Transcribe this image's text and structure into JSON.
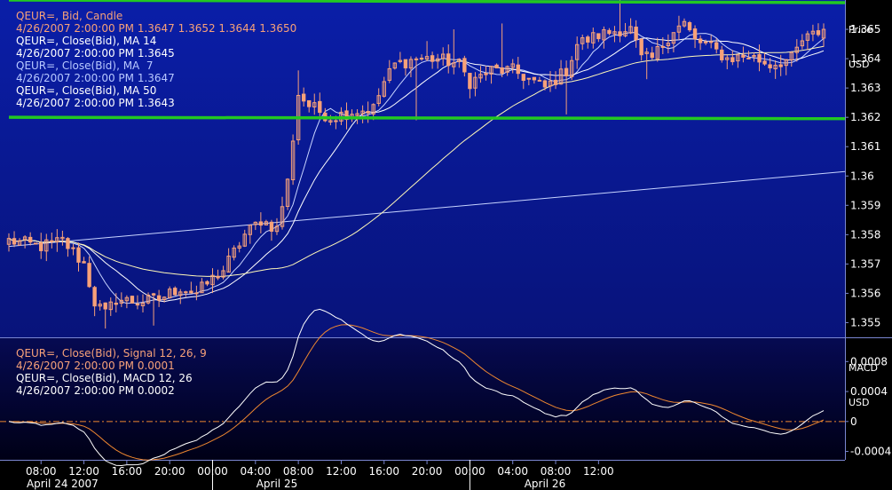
{
  "colors": {
    "background_top": "#0a1ea8",
    "background_bottom": "#000016",
    "candle_up": "#f7a179",
    "candle_down": "#f7a179",
    "ma14": "#ffffff",
    "ma7": "#c8d4ff",
    "ma50": "#fff8b8",
    "trendline": "#c8d4ff",
    "hline": "#22c822",
    "macd": "#ffffff",
    "signal": "#f08830",
    "zero_line": "#f08830",
    "text_orange": "#f7a179",
    "text_white": "#ffffff",
    "text_lightblue": "#b8c8ff"
  },
  "price_legend": [
    {
      "text": "QEUR=, Bid, Candle",
      "color": "orange"
    },
    {
      "text": "4/26/2007 2:00:00 PM 1.3647 1.3652 1.3644 1.3650",
      "color": "orange"
    },
    {
      "text": "QEUR=, Close(Bid), MA 14",
      "color": "white"
    },
    {
      "text": "4/26/2007 2:00:00 PM 1.3645",
      "color": "white"
    },
    {
      "text": "QEUR=, Close(Bid), MA  7",
      "color": "lightblue"
    },
    {
      "text": "4/26/2007 2:00:00 PM 1.3647",
      "color": "lightblue"
    },
    {
      "text": "QEUR=, Close(Bid), MA 50",
      "color": "white"
    },
    {
      "text": "4/26/2007 2:00:00 PM 1.3643",
      "color": "white"
    }
  ],
  "macd_legend": [
    {
      "text": "QEUR=, Close(Bid), Signal 12, 26, 9",
      "color": "orange"
    },
    {
      "text": "4/26/2007 2:00:00 PM 0.0001",
      "color": "orange"
    },
    {
      "text": "QEUR=, Close(Bid), MACD 12, 26",
      "color": "white"
    },
    {
      "text": "4/26/2007 2:00:00 PM 0.0002",
      "color": "white"
    }
  ],
  "price_axis_title": [
    "Price",
    "USD"
  ],
  "macd_axis_title": [
    "MACD",
    "USD"
  ],
  "chart_data": [
    {
      "type": "candlestick",
      "instrument": "QEUR=",
      "ylim": [
        1.3545,
        1.366
      ],
      "yticks": [
        "1.355",
        "1.356",
        "1.357",
        "1.358",
        "1.359",
        "1.36",
        "1.361",
        "1.362",
        "1.363",
        "1.364",
        "1.365",
        "Price"
      ],
      "yticks_values": [
        1.355,
        1.356,
        1.357,
        1.358,
        1.359,
        1.36,
        1.361,
        1.362,
        1.363,
        1.364,
        1.365
      ],
      "grid": false,
      "candle_count": 153,
      "x_start": "4/24/2007 05:00",
      "x_step_minutes": 30,
      "anchors_close": [
        [
          0,
          1.3578
        ],
        [
          6,
          1.3576
        ],
        [
          10,
          1.3578
        ],
        [
          14,
          1.357
        ],
        [
          16,
          1.3557
        ],
        [
          18,
          1.3553
        ],
        [
          20,
          1.3558
        ],
        [
          24,
          1.3557
        ],
        [
          28,
          1.3558
        ],
        [
          32,
          1.3562
        ],
        [
          35,
          1.356
        ],
        [
          38,
          1.3565
        ],
        [
          40,
          1.3568
        ],
        [
          44,
          1.358
        ],
        [
          47,
          1.3585
        ],
        [
          50,
          1.3582
        ],
        [
          52,
          1.3598
        ],
        [
          54,
          1.3628
        ],
        [
          56,
          1.3624
        ],
        [
          60,
          1.362
        ],
        [
          64,
          1.3622
        ],
        [
          68,
          1.3623
        ],
        [
          70,
          1.3632
        ],
        [
          72,
          1.3638
        ],
        [
          76,
          1.364
        ],
        [
          80,
          1.364
        ],
        [
          84,
          1.3638
        ],
        [
          86,
          1.3632
        ],
        [
          90,
          1.3636
        ],
        [
          94,
          1.3636
        ],
        [
          98,
          1.3632
        ],
        [
          100,
          1.363
        ],
        [
          104,
          1.3636
        ],
        [
          106,
          1.3645
        ],
        [
          110,
          1.3648
        ],
        [
          114,
          1.365
        ],
        [
          116,
          1.365
        ],
        [
          118,
          1.364
        ],
        [
          120,
          1.364
        ],
        [
          124,
          1.365
        ],
        [
          126,
          1.3652
        ],
        [
          128,
          1.3646
        ],
        [
          130,
          1.3645
        ],
        [
          134,
          1.364
        ],
        [
          138,
          1.3641
        ],
        [
          142,
          1.3638
        ],
        [
          146,
          1.364
        ],
        [
          148,
          1.3646
        ],
        [
          150,
          1.3648
        ],
        [
          152,
          1.365
        ]
      ],
      "spikes": [
        {
          "index": 18,
          "low": 1.3548
        },
        {
          "index": 27,
          "low": 1.3549
        },
        {
          "index": 54,
          "high": 1.3636
        },
        {
          "index": 76,
          "low": 1.3619
        },
        {
          "index": 78,
          "high": 1.3646
        },
        {
          "index": 83,
          "high": 1.365
        },
        {
          "index": 92,
          "high": 1.3652
        },
        {
          "index": 104,
          "low": 1.3621
        },
        {
          "index": 114,
          "high": 1.366
        },
        {
          "index": 119,
          "low": 1.3633
        }
      ],
      "last_candle": {
        "time": "4/26/2007 2:00:00 PM",
        "open": 1.3647,
        "high": 1.3652,
        "low": 1.3644,
        "close": 1.365
      },
      "moving_averages": [
        {
          "name": "MA 7",
          "period": 7,
          "last": 1.3647
        },
        {
          "name": "MA 14",
          "period": 14,
          "last": 1.3645
        },
        {
          "name": "MA 50",
          "period": 50,
          "last": 1.3643
        }
      ],
      "horizontal_lines": [
        1.366,
        1.362
      ],
      "trendline": {
        "from": [
          0,
          1.3576
        ],
        "to": [
          152,
          1.36
        ]
      }
    },
    {
      "type": "line",
      "ylim": [
        -0.0005,
        0.0011
      ],
      "yticks": [
        "-0.0004",
        "0",
        "0.0004",
        "0.0008"
      ],
      "yticks_values": [
        -0.0004,
        0,
        0.0004,
        0.0008
      ],
      "series": [
        {
          "name": "MACD 12, 26",
          "last": 0.0002
        },
        {
          "name": "Signal 12, 26, 9",
          "last": 0.0001
        }
      ],
      "zero_line": true
    }
  ],
  "x_axis": {
    "time_labels": [
      "08:00",
      "12:00",
      "16:00",
      "20:00",
      "00:00",
      "04:00",
      "08:00",
      "12:00",
      "16:00",
      "20:00",
      "00:00",
      "04:00",
      "08:00",
      "12:00"
    ],
    "time_label_hours": [
      3,
      7,
      11,
      15,
      19,
      23,
      27,
      31,
      35,
      39,
      43,
      47,
      51,
      55
    ],
    "date_labels": [
      {
        "text": "April 24 2007",
        "hour": 5
      },
      {
        "text": "April 25",
        "hour": 25
      },
      {
        "text": "April 26",
        "hour": 50
      }
    ],
    "day_dividers_hours": [
      19,
      43
    ]
  }
}
